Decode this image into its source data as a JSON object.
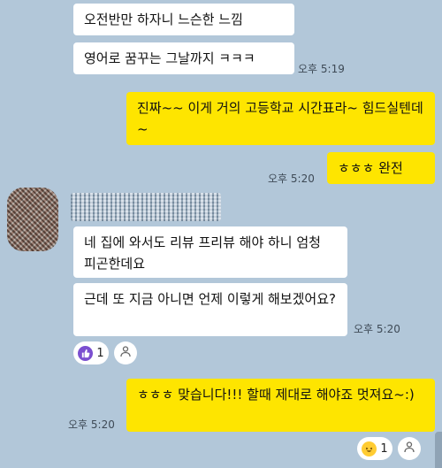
{
  "messages": {
    "m1": "오전반만 하자니 느슨한 느낌",
    "m2": "영어로 꿈꾸는 그날까지 ㅋㅋㅋ",
    "t1": "오후 5:19",
    "m3": "진짜~~ 이게 거의 고등학교 시간표라~ 힘드실텐데~",
    "m4": "ㅎㅎㅎ 완전",
    "t2": "오후 5:20",
    "m5": "네 집에 와서도 리뷰 프리뷰 해야 하니 엄청 피곤한데요",
    "m6": "근데 또 지금 아니면 언제 이렇게 해보겠어요?",
    "t3": "오후 5:20",
    "m7": "ㅎㅎㅎ 맞습니다!!! 할때 제대로 해야죠 멋져요~:)",
    "t4": "오후 5:20"
  },
  "reactions": {
    "r1_count": "1",
    "r2_count": "1"
  },
  "icons": {
    "reaction_purple": "thumbs-up-icon",
    "reaction_emoji": "laughing-emoji-icon",
    "add_reaction": "person-icon"
  },
  "colors": {
    "background": "#b2c7d9",
    "my_bubble": "#fee500",
    "their_bubble": "#ffffff"
  }
}
